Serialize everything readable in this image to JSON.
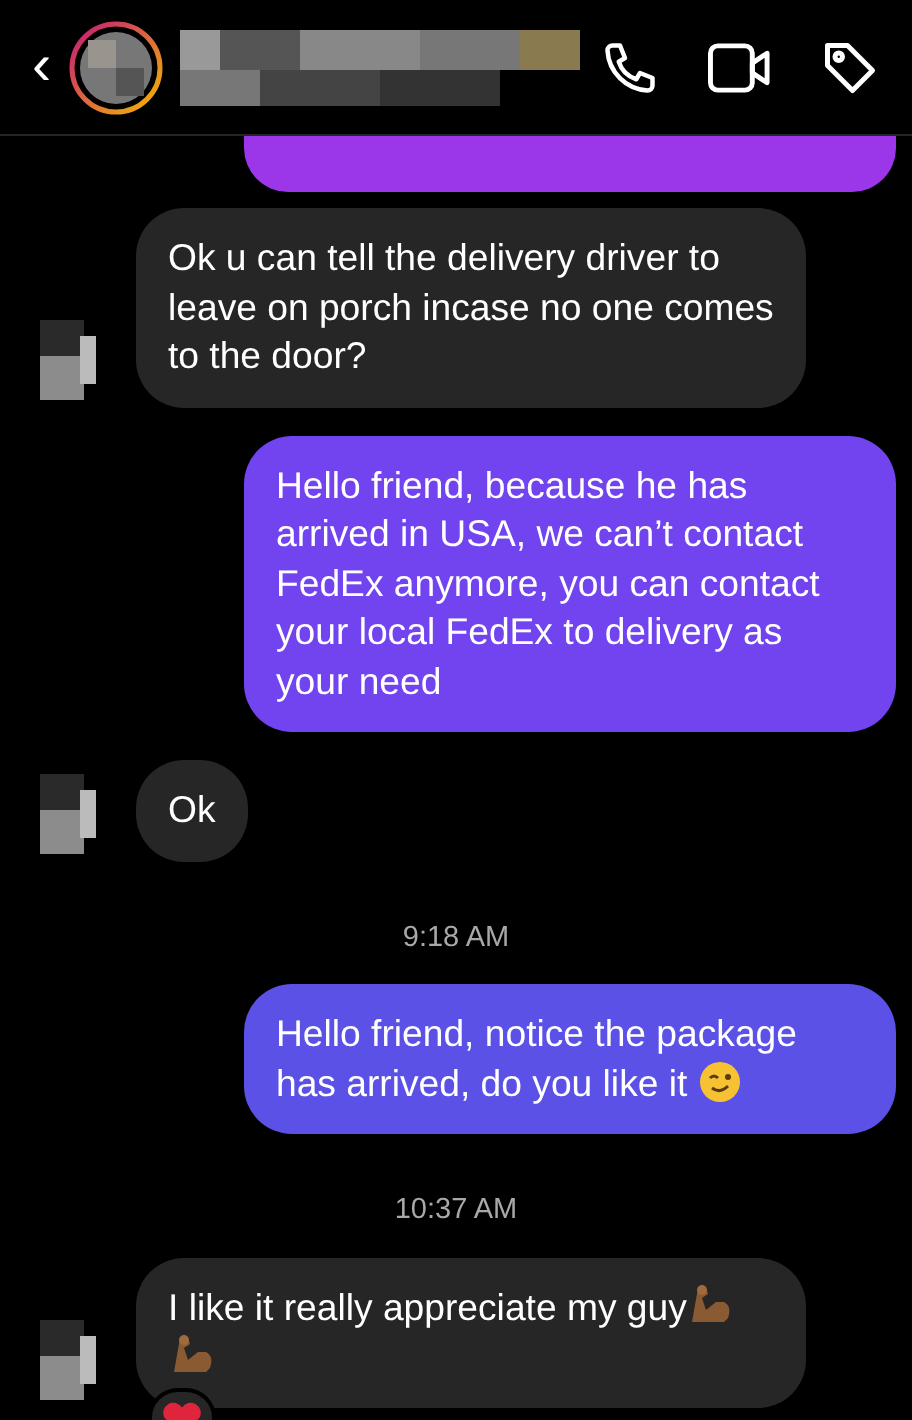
{
  "header": {
    "back": "‹"
  },
  "messages": [
    {
      "kind": "clipped",
      "outgoing": true,
      "color": "#9b37e9"
    },
    {
      "kind": "text",
      "outgoing": false,
      "text": "Ok u can tell the delivery driver to leave on porch incase no one comes to the door?",
      "avatar": true
    },
    {
      "kind": "text",
      "outgoing": true,
      "text": "Hello friend, because he has arrived in USA, we can’t contact FedEx anymore, you can contact your local FedEx to delivery as your need",
      "color": "#7144f0"
    },
    {
      "kind": "text",
      "outgoing": false,
      "text": "Ok",
      "avatar": true
    },
    {
      "kind": "time",
      "text": "9:18 AM"
    },
    {
      "kind": "text",
      "outgoing": true,
      "text": "Hello friend, notice the package has arrived, do you like it",
      "emoji": [
        {
          "kind": "wink"
        }
      ],
      "color": "#5b51e6"
    },
    {
      "kind": "time",
      "text": "10:37 AM"
    },
    {
      "kind": "text",
      "outgoing": false,
      "text": "I like it really appreciate my guy",
      "emoji": [
        {
          "kind": "biceps"
        },
        {
          "kind": "biceps"
        }
      ],
      "avatar": true,
      "reaction": {
        "kind": "heart"
      }
    }
  ]
}
